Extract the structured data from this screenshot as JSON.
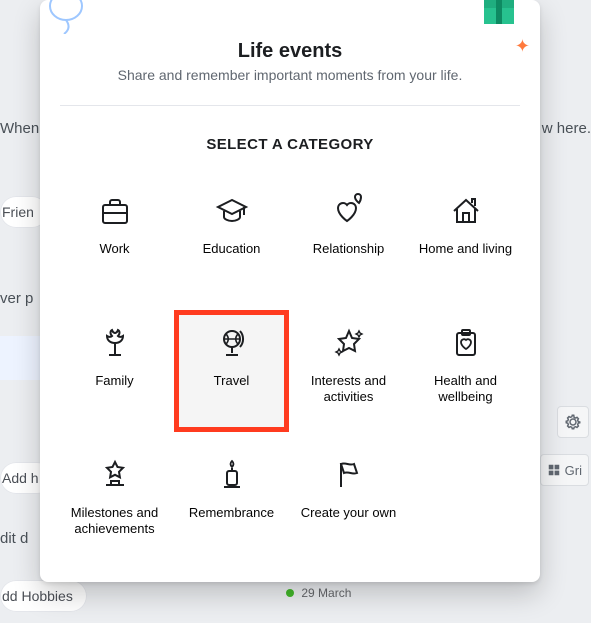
{
  "modal": {
    "title": "Life events",
    "subtitle": "Share and remember important moments from your life.",
    "select_heading": "SELECT A CATEGORY",
    "categories": [
      {
        "key": "work",
        "label": "Work",
        "icon": "briefcase",
        "highlight": false
      },
      {
        "key": "education",
        "label": "Education",
        "icon": "grad-cap",
        "highlight": false
      },
      {
        "key": "relationship",
        "label": "Relationship",
        "icon": "hearts",
        "highlight": false
      },
      {
        "key": "home",
        "label": "Home and living",
        "icon": "house",
        "highlight": false
      },
      {
        "key": "family",
        "label": "Family",
        "icon": "family-tree",
        "highlight": false
      },
      {
        "key": "travel",
        "label": "Travel",
        "icon": "globe-stand",
        "highlight": true
      },
      {
        "key": "interests",
        "label": "Interests and activities",
        "icon": "sparkle-star",
        "highlight": false
      },
      {
        "key": "health",
        "label": "Health and wellbeing",
        "icon": "clipboard-heart",
        "highlight": false
      },
      {
        "key": "milestones",
        "label": "Milestones and achievements",
        "icon": "star-podium",
        "highlight": false
      },
      {
        "key": "remembrance",
        "label": "Remembrance",
        "icon": "candle",
        "highlight": false
      },
      {
        "key": "create",
        "label": "Create your own",
        "icon": "flag",
        "highlight": false
      }
    ]
  },
  "background": {
    "line1": "When y",
    "line1b": "w here.",
    "friends": "Frien",
    "verp": "ver p",
    "add1": "Add h",
    "edit": "dit d",
    "addhobbies": "dd Hobbies",
    "date_tag": "29 March",
    "grid_label": "Gri"
  }
}
